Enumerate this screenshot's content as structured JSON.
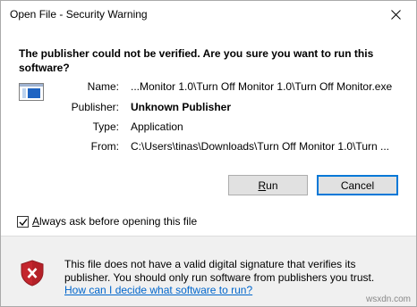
{
  "window": {
    "title": "Open File - Security Warning",
    "close_icon": "close-icon"
  },
  "headline": "The publisher could not be verified.  Are you sure you want to run this software?",
  "fields": {
    "name_label": "Name:",
    "name_value": "...Monitor 1.0\\Turn Off Monitor 1.0\\Turn Off Monitor.exe",
    "publisher_label": "Publisher:",
    "publisher_value": "Unknown Publisher",
    "type_label": "Type:",
    "type_value": "Application",
    "from_label": "From:",
    "from_value": "C:\\Users\\tinas\\Downloads\\Turn Off Monitor 1.0\\Turn ..."
  },
  "buttons": {
    "run_prefix": "",
    "run_underlined": "R",
    "run_suffix": "un",
    "cancel": "Cancel"
  },
  "checkbox": {
    "checked": true,
    "label_prefix": "",
    "label_underlined": "A",
    "label_suffix": "lways ask before opening this file"
  },
  "warning": {
    "text": "This file does not have a valid digital signature that verifies its publisher.  You should only run software from publishers you trust.",
    "link": "How can I decide what software to run?",
    "icon": "shield-error-icon"
  },
  "watermark": "wsxdn.com",
  "colors": {
    "accent": "#0078d7",
    "link": "#0066cc",
    "shield_red": "#c4262e"
  }
}
